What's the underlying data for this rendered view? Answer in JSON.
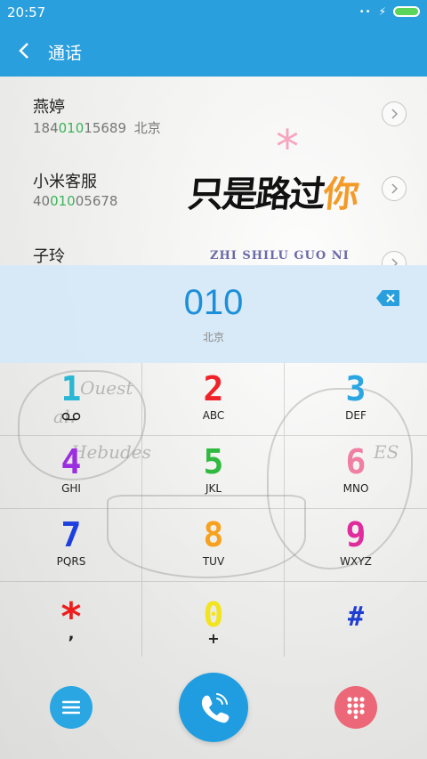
{
  "status_bar": {
    "time": "20:57",
    "signal_dots": "••",
    "charging_symbol": "⚡"
  },
  "header": {
    "title": "通话"
  },
  "contacts": [
    {
      "name": "燕婷",
      "number_pre": "184",
      "number_match": "010",
      "number_post": "15689",
      "location": "北京"
    },
    {
      "name": "小米客服",
      "number_pre": "40",
      "number_match": "010",
      "number_post": "05678",
      "location": ""
    },
    {
      "name": "子玲",
      "number_pre": "",
      "number_match": "",
      "number_post": "",
      "location": ""
    }
  ],
  "banner": {
    "text_main": "只是路过",
    "text_accent": "你",
    "flower": "*",
    "pinyin": "ZHI SHILU GUO NI"
  },
  "dial_display": {
    "digits": "010",
    "location": "北京"
  },
  "keys": [
    {
      "digit": "1",
      "letters": "",
      "color": "#29b7d3"
    },
    {
      "digit": "2",
      "letters": "ABC",
      "color": "#f0232a"
    },
    {
      "digit": "3",
      "letters": "DEF",
      "color": "#2aa6e3"
    },
    {
      "digit": "4",
      "letters": "GHI",
      "color": "#9b2ee0"
    },
    {
      "digit": "5",
      "letters": "JKL",
      "color": "#2fba3f"
    },
    {
      "digit": "6",
      "letters": "MNO",
      "color": "#f07fa3"
    },
    {
      "digit": "7",
      "letters": "PQRS",
      "color": "#1c3fe0"
    },
    {
      "digit": "8",
      "letters": "TUV",
      "color": "#f7a21f"
    },
    {
      "digit": "9",
      "letters": "WXYZ",
      "color": "#e02c9c"
    },
    {
      "digit": "*",
      "letters": ",",
      "color": "#ee1c1c"
    },
    {
      "digit": "0",
      "letters": "+",
      "color": "#f2e41f"
    },
    {
      "digit": "#",
      "letters": "",
      "color": "#1f3fd2"
    }
  ],
  "colors": {
    "header_bg": "#2a9fdd",
    "match_highlight": "#3cb35a",
    "call_button": "#1f9de0",
    "menu_button": "#2aa6e3",
    "keypad_toggle": "#ec6777"
  }
}
